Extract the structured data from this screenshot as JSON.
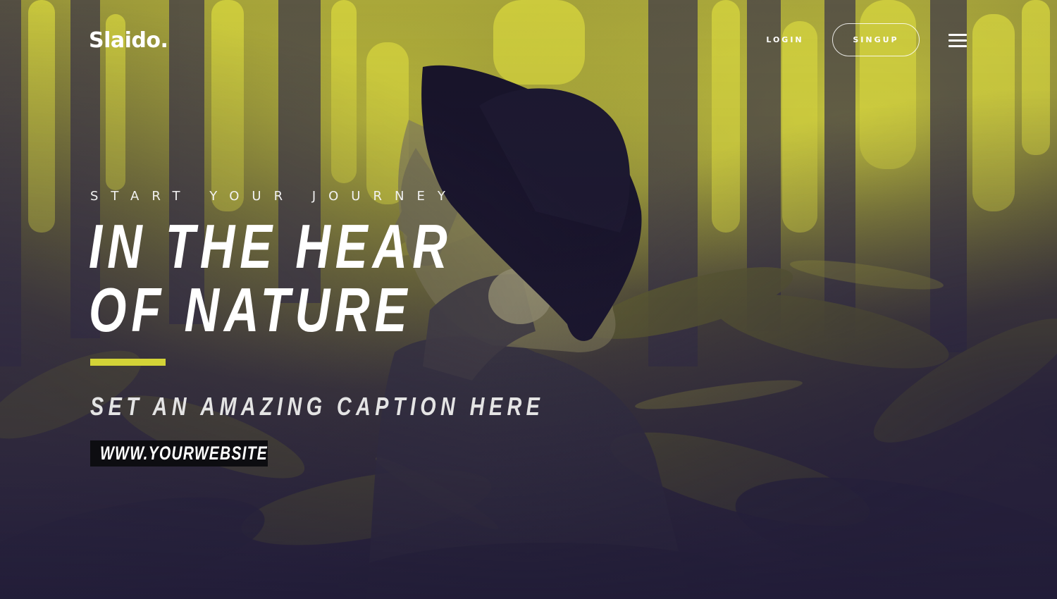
{
  "header": {
    "logo": "Slaido.",
    "login_label": "LOGIN",
    "signup_label": "SINGUP",
    "menu_icon": "hamburger-menu-icon"
  },
  "hero": {
    "eyebrow": "START YOUR JOURNEY",
    "headline_line1": "IN THE HEAR",
    "headline_line2": "OF NATURE",
    "caption": "SET AN AMAZING CAPTION HERE",
    "url": "WWW.YOURWEBSITE.COM"
  },
  "colors": {
    "accent": "#d3d337",
    "background_dark": "#2a2440",
    "background_light": "#d8d83c",
    "badge_bg": "#0d0d11",
    "text": "#ffffff"
  }
}
